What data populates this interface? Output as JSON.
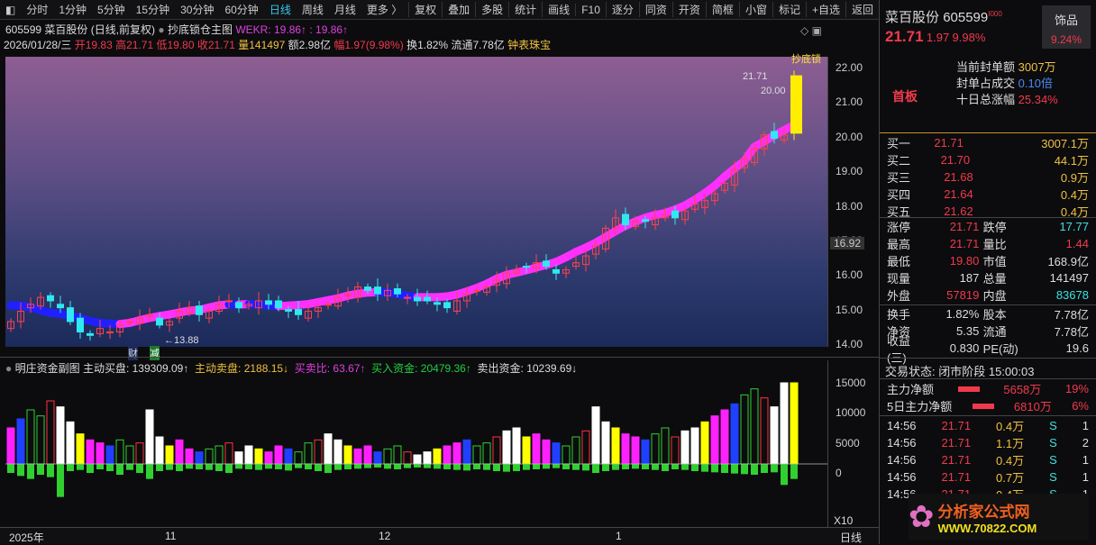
{
  "toolbar": {
    "periods": [
      "分时",
      "1分钟",
      "5分钟",
      "15分钟",
      "30分钟",
      "60分钟",
      "日线",
      "周线",
      "月线",
      "更多 〉"
    ],
    "active": "日线",
    "actions": [
      "复权",
      "叠加",
      "多股",
      "统计",
      "画线",
      "F10",
      "逐分",
      "同资",
      "开资",
      "简框",
      "小窗",
      "标记",
      "+自选",
      "返回"
    ]
  },
  "header": {
    "title": "605599 菜百股份 (日线,前复权)",
    "indicator": "抄底锁仓主图",
    "wekr": "WEKR: 19.86↑",
    "wekr2": ": 19.86↑"
  },
  "quote_line": {
    "date": "2026/01/28/三",
    "open": "开19.83",
    "high": "高21.71",
    "low": "低19.80",
    "close": "收21.71",
    "vol": "量141497",
    "amount": "额2.98亿",
    "change": "幅1.97(9.98%)",
    "turnover": "换1.82%",
    "float": "流通7.78亿",
    "sector": "钟表珠宝"
  },
  "price_axis": {
    "ticks": [
      "22.00",
      "21.00",
      "20.00",
      "19.00",
      "18.00",
      "17.00",
      "16.00",
      "15.00",
      "14.00"
    ],
    "cursor": "16.92"
  },
  "annotations": {
    "high": "21.71",
    "limit": "20.00",
    "low": "←13.88",
    "tag_cai": "财",
    "tag_jian": "减",
    "topright": "抄底锁"
  },
  "chart_data": {
    "type": "candlestick",
    "ylim": [
      14,
      22
    ],
    "closes": [
      14.6,
      14.9,
      15.1,
      15.3,
      15.2,
      15.0,
      14.6,
      14.3,
      14.2,
      14.4,
      14.3,
      14.5,
      14.6,
      14.7,
      14.8,
      14.5,
      14.6,
      14.9,
      15.0,
      14.8,
      14.9,
      15.1,
      15.2,
      15.0,
      15.1,
      15.2,
      15.1,
      15.0,
      14.9,
      14.8,
      14.9,
      15.0,
      15.1,
      15.3,
      15.4,
      15.6,
      15.5,
      15.4,
      15.5,
      15.4,
      15.3,
      15.2,
      15.2,
      15.1,
      15.0,
      15.2,
      15.4,
      15.5,
      15.6,
      15.8,
      16.0,
      16.1,
      16.2,
      16.3,
      16.2,
      16.0,
      16.1,
      16.3,
      16.5,
      16.8,
      17.3,
      17.6,
      17.4,
      17.5,
      17.5,
      17.6,
      17.7,
      17.6,
      17.8,
      18.0,
      18.1,
      18.3,
      18.6,
      19.0,
      19.3,
      19.6,
      20.0,
      19.9,
      20.0,
      21.71
    ],
    "volumes": [
      6000,
      7500,
      9000,
      8000,
      10500,
      9500,
      7000,
      5000,
      4000,
      3500,
      3000,
      4000,
      3000,
      3500,
      9000,
      4500,
      3000,
      4000,
      2500,
      2000,
      2500,
      3000,
      3500,
      2000,
      3000,
      2500,
      2000,
      3000,
      2500,
      2000,
      3500,
      4000,
      5000,
      4000,
      3000,
      2500,
      3000,
      2000,
      2500,
      3000,
      2000,
      1500,
      2000,
      2500,
      3000,
      3500,
      4000,
      3000,
      3500,
      4500,
      5500,
      6000,
      4500,
      5000,
      4000,
      3500,
      3000,
      4500,
      5500,
      9500,
      7000,
      6000,
      5000,
      4500,
      4000,
      5000,
      6000,
      4500,
      5500,
      6000,
      7000,
      8000,
      9000,
      10000,
      11500,
      12500,
      11000,
      9500,
      13500,
      13500
    ],
    "sells": [
      1500,
      2000,
      2500,
      1800,
      2200,
      5500,
      1200,
      1000,
      1500,
      900,
      1200,
      1800,
      1000,
      1500,
      2500,
      1200,
      1000,
      1200,
      800,
      900,
      1000,
      1200,
      1500,
      800,
      900,
      1000,
      800,
      900,
      1100,
      700,
      900,
      1200,
      1500,
      1000,
      900,
      800,
      700,
      600,
      800,
      900,
      700,
      600,
      700,
      800,
      900,
      1000,
      1100,
      900,
      1000,
      1200,
      1300,
      1200,
      1000,
      900,
      800,
      700,
      900,
      1000,
      1100,
      1500,
      1200,
      1000,
      900,
      800,
      900,
      1000,
      1200,
      900,
      1000,
      1200,
      1300,
      1400,
      1500,
      1600,
      1700,
      1800,
      1500,
      1400,
      3500,
      2500
    ]
  },
  "sub": {
    "title": "明庄资金副图",
    "buy": "主动买盘: 139309.09↑",
    "sell": "主动卖盘: 2188.15↓",
    "ratio": "买卖比: 63.67↑",
    "in": "买入资金: 20479.36↑",
    "out": "卖出资金: 10239.69↓",
    "ticks": [
      "15000",
      "10000",
      "5000",
      "0"
    ]
  },
  "xaxis": {
    "labels": [
      "2025年",
      "11",
      "12",
      "1"
    ],
    "zoom": "X10",
    "period": "日线"
  },
  "right": {
    "name": "菜百股份",
    "code": "605599",
    "price": "21.71",
    "chg": "1.97",
    "pct": "9.98%",
    "sector": "饰品",
    "sector_pct": "9.24%",
    "board": "首板",
    "seal_label": "当前封单额",
    "seal": "3007万",
    "ratio_label": "封单占成交",
    "ratio": "0.10倍",
    "ten_label": "十日总涨幅",
    "ten": "25.34%",
    "bids": [
      [
        "买一",
        "21.71",
        "3007.1万"
      ],
      [
        "买二",
        "21.70",
        "44.1万"
      ],
      [
        "买三",
        "21.68",
        "0.9万"
      ],
      [
        "买四",
        "21.64",
        "0.4万"
      ],
      [
        "买五",
        "21.62",
        "0.4万"
      ]
    ],
    "stats": [
      [
        "涨停",
        "21.71",
        "跌停",
        "17.77"
      ],
      [
        "最高",
        "21.71",
        "量比",
        "1.44"
      ],
      [
        "最低",
        "19.80",
        "市值",
        "168.9亿"
      ],
      [
        "现量",
        "187",
        "总量",
        "141497"
      ],
      [
        "外盘",
        "57819",
        "内盘",
        "83678"
      ]
    ],
    "stats2": [
      [
        "换手",
        "1.82%",
        "股本",
        "7.78亿"
      ],
      [
        "净资",
        "5.35",
        "流通",
        "7.78亿"
      ],
      [
        "收益(三)",
        "0.830",
        "PE(动)",
        "19.6"
      ]
    ],
    "status": "交易状态: 闭市阶段 15:00:03",
    "flow": [
      [
        "主力净额",
        "5658万",
        "19%"
      ],
      [
        "5日主力净额",
        "6810万",
        "6%"
      ]
    ],
    "ticks": [
      [
        "14:56",
        "21.71",
        "0.4万",
        "S",
        "1"
      ],
      [
        "14:56",
        "21.71",
        "1.1万",
        "S",
        "2"
      ],
      [
        "14:56",
        "21.71",
        "0.4万",
        "S",
        "1"
      ],
      [
        "14:56",
        "21.71",
        "0.7万",
        "S",
        "1"
      ],
      [
        "14:56",
        "21.71",
        "0.4万",
        "S",
        "1"
      ]
    ],
    "logo_text": "分析家公式网",
    "logo_url": "WWW.70822.COM"
  }
}
